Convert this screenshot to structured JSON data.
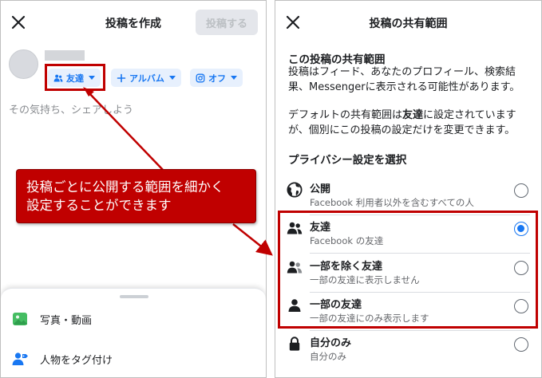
{
  "left_screen": {
    "title": "投稿を作成",
    "post_button": "投稿する",
    "pills": {
      "friends": "友達",
      "album": "アルバム",
      "instagram": "オフ"
    },
    "composer_placeholder": "その気持ち、シェアしよう",
    "sheet_items": [
      {
        "label": "写真・動画",
        "icon": "photo-icon"
      },
      {
        "label": "人物をタグ付け",
        "icon": "tag-people-icon"
      }
    ]
  },
  "callout": {
    "line1": "投稿ごとに公開する範囲を細かく",
    "line2": "設定することができます"
  },
  "right_screen": {
    "title": "投稿の共有範囲",
    "section_title": "この投稿の共有範囲",
    "para1_line1": "投稿はフィード、あなたのプロフィール、検索結",
    "para1_line2": "果、Messengerに表示される可能性があります。",
    "para2_line1_before": "デフォルトの共有範囲は",
    "para2_line1_bold": "友達",
    "para2_line1_after": "に設定されています",
    "para2_line2": "が、個別にこの投稿の設定だけを変更できます。",
    "choose_title": "プライバシー設定を選択",
    "options": [
      {
        "title": "公開",
        "subtitle": "Facebook 利用者以外を含むすべての人",
        "icon": "globe-icon",
        "selected": false
      },
      {
        "title": "友達",
        "subtitle": "Facebook の友達",
        "icon": "friends-icon",
        "selected": true
      },
      {
        "title": "一部を除く友達",
        "subtitle": "一部の友達に表示しません",
        "icon": "friends-except-icon",
        "selected": false
      },
      {
        "title": "一部の友達",
        "subtitle": "一部の友達にのみ表示します",
        "icon": "person-icon",
        "selected": false
      },
      {
        "title": "自分のみ",
        "subtitle": "自分のみ",
        "icon": "lock-icon",
        "selected": false
      }
    ]
  },
  "colors": {
    "accent": "#1877f2",
    "highlight": "#c00000",
    "pill_bg": "#e7f0fd"
  }
}
